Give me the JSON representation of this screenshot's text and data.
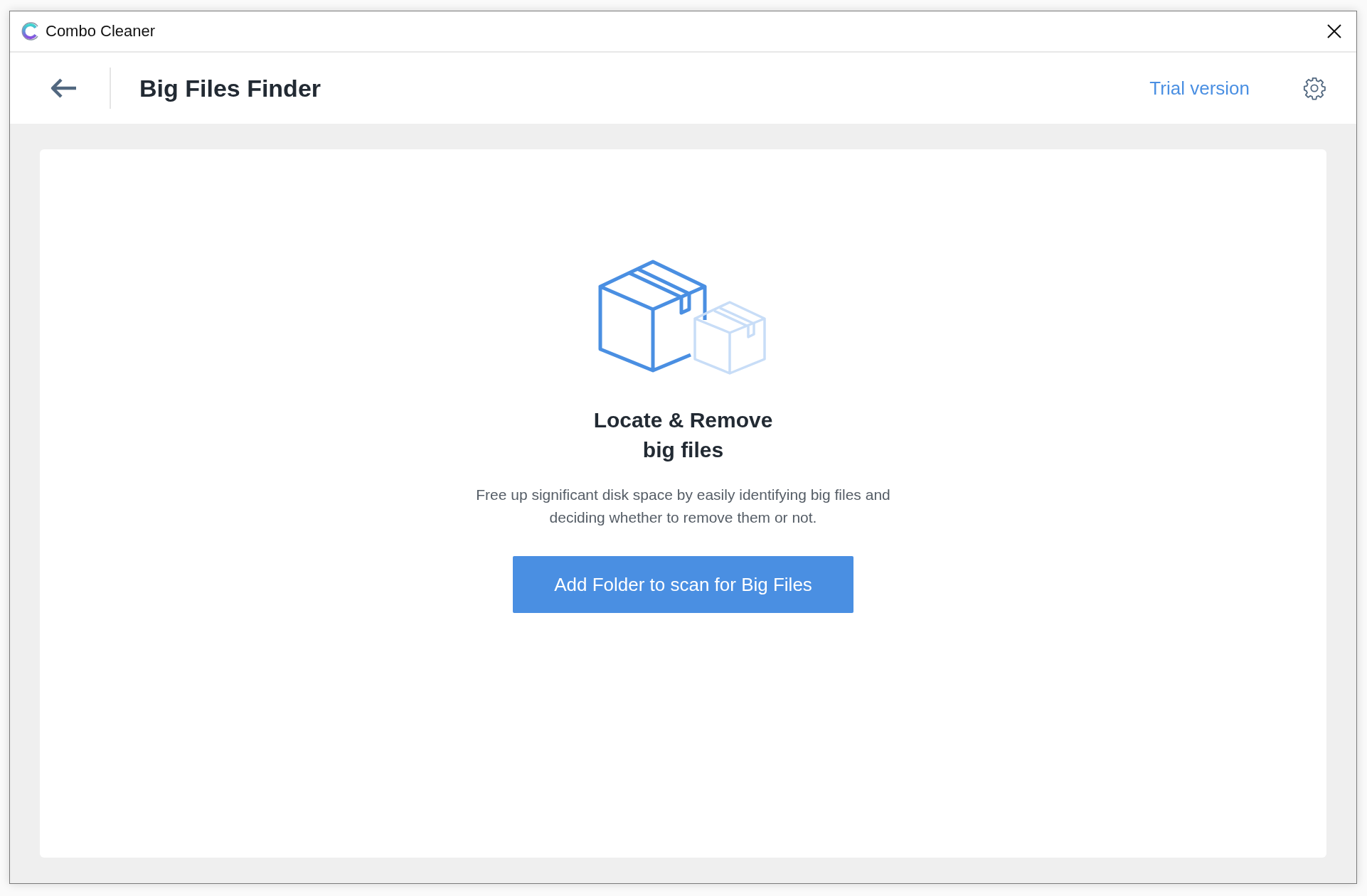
{
  "window": {
    "title": "Combo Cleaner"
  },
  "header": {
    "title": "Big Files Finder",
    "trial_link": "Trial version"
  },
  "content": {
    "heading": "Locate & Remove big files",
    "description": "Free up significant disk space by easily identifying big files and deciding whether to remove them or not.",
    "button": "Add Folder to scan for Big Files"
  }
}
